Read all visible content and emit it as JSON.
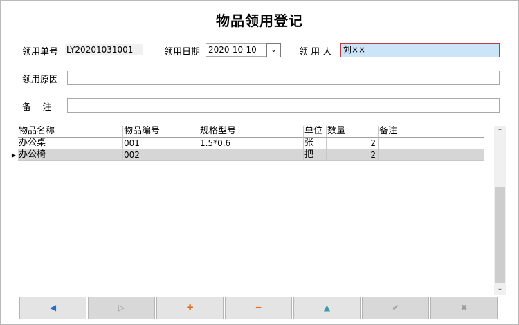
{
  "title": "物品领用登记",
  "form": {
    "order_no_label": "领用单号",
    "order_no": "LY20201031001",
    "date_label": "领用日期",
    "date": "2020-10-10",
    "date_btn": "⌄",
    "person_label": "领 用 人",
    "person": "刘××",
    "reason_label": "领用原因",
    "reason": "",
    "remark_label": "备    注",
    "remark": ""
  },
  "table": {
    "columns": [
      "物品名称",
      "物品编号",
      "规格型号",
      "单位",
      "数量",
      "备注"
    ],
    "rows": [
      [
        "办公桌",
        "001",
        "1.5*0.6",
        "张",
        "2",
        ""
      ],
      [
        "办公椅",
        "002",
        "",
        "把",
        "2",
        ""
      ]
    ],
    "current_row_marker": "▶"
  },
  "scrollbar": {
    "up": "⌃",
    "down": "⌄"
  },
  "toolbar": {
    "prev": "◀",
    "next": "▷",
    "add": "✚",
    "remove": "━",
    "up": "▲",
    "confirm": "✔",
    "cancel": "✖",
    "colors": {
      "blue": "#1f6fd1",
      "orange": "#e06b1a",
      "teal": "#3a9aae",
      "gray": "#9a9a9a"
    }
  }
}
